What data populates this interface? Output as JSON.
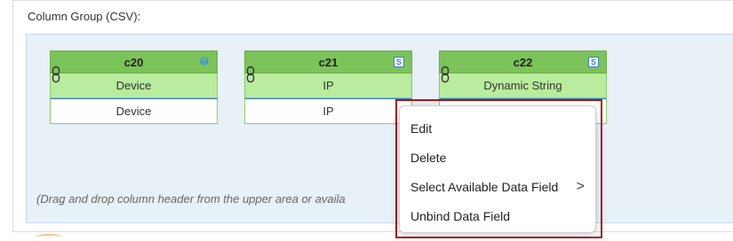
{
  "section": {
    "label": "Column Group (CSV):"
  },
  "columns": [
    {
      "name": "c20",
      "badge_icon": "database-icon",
      "field": "Device",
      "value": "Device"
    },
    {
      "name": "c21",
      "badge_icon": "string-type-icon",
      "badge_text": "S",
      "field": "IP",
      "value": "IP"
    },
    {
      "name": "c22",
      "badge_icon": "string-type-icon",
      "badge_text": "S",
      "field": "Dynamic String",
      "value": ""
    }
  ],
  "hint": "(Drag and drop column header from the upper area or availa",
  "context_menu": {
    "items": [
      {
        "label": "Edit"
      },
      {
        "label": "Delete"
      },
      {
        "label": "Select Available Data Field",
        "has_submenu": true,
        "submenu_icon": "chevron-right-icon",
        "submenu_glyph": ">"
      },
      {
        "label": "Unbind Data Field"
      }
    ]
  },
  "colors": {
    "header_green": "#7cc35a",
    "row_green": "#b9ec9e",
    "highlight_red": "#a8161c",
    "drop_area": "#e8f0f8"
  }
}
